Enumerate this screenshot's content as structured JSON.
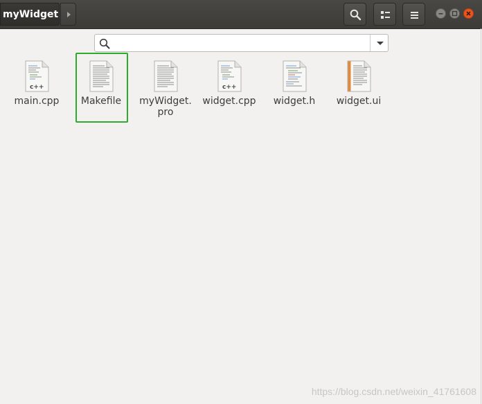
{
  "window": {
    "title": "myWidget",
    "controls": [
      "minimize-icon",
      "maximize-icon",
      "close-icon"
    ]
  },
  "headerbar": {
    "path_button": "myWidget",
    "buttons": [
      "search-icon",
      "view-toggle-icon",
      "menu-icon"
    ]
  },
  "location": {
    "value": "",
    "icon": "search-icon"
  },
  "files": [
    {
      "name": "main.cpp",
      "type": "cpp"
    },
    {
      "name": "Makefile",
      "type": "text",
      "selected": true
    },
    {
      "name": "myWidget.\npro",
      "type": "text"
    },
    {
      "name": "widget.cpp",
      "type": "cpp"
    },
    {
      "name": "widget.h",
      "type": "header"
    },
    {
      "name": "widget.ui",
      "type": "ui"
    }
  ],
  "watermark": "https://blog.csdn.net/weixin_41761608",
  "colors": {
    "headerbar": "#3c3b37",
    "background": "#f2f1f0",
    "selection_outline": "#2eaa2e",
    "close_button": "#e95420"
  }
}
